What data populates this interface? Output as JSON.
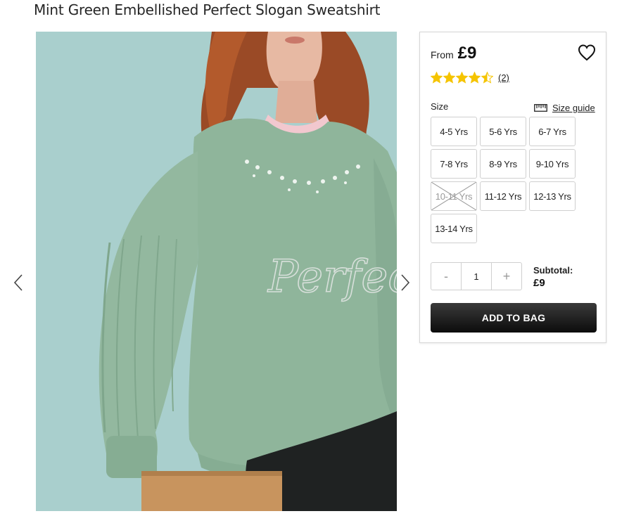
{
  "product": {
    "title": "Mint Green Embellished Perfect Slogan Sweatshirt"
  },
  "gallery": {
    "image_text": "Perfect",
    "prev_icon": "chevron-left-icon",
    "next_icon": "chevron-right-icon"
  },
  "pricing": {
    "prefix": "From",
    "price": "£9"
  },
  "wishlist": {
    "icon": "heart-icon"
  },
  "rating": {
    "stars": 4.5,
    "max": 5,
    "count_label": "(2)",
    "star_color": "#f5c400"
  },
  "size": {
    "label": "Size",
    "guide_icon": "ruler-icon",
    "guide_label": "Size guide",
    "options": [
      {
        "label": "4-5 Yrs",
        "available": true
      },
      {
        "label": "5-6 Yrs",
        "available": true
      },
      {
        "label": "6-7 Yrs",
        "available": true
      },
      {
        "label": "7-8 Yrs",
        "available": true
      },
      {
        "label": "8-9 Yrs",
        "available": true
      },
      {
        "label": "9-10 Yrs",
        "available": true
      },
      {
        "label": "10-11 Yrs",
        "available": false
      },
      {
        "label": "11-12 Yrs",
        "available": true
      },
      {
        "label": "12-13 Yrs",
        "available": true
      },
      {
        "label": "13-14 Yrs",
        "available": true
      }
    ]
  },
  "quantity": {
    "decrement": "-",
    "value": "1",
    "increment": "+"
  },
  "subtotal": {
    "label": "Subtotal:",
    "value": "£9"
  },
  "cart": {
    "add_label": "ADD TO BAG",
    "button_color": "#1a1a1a"
  }
}
